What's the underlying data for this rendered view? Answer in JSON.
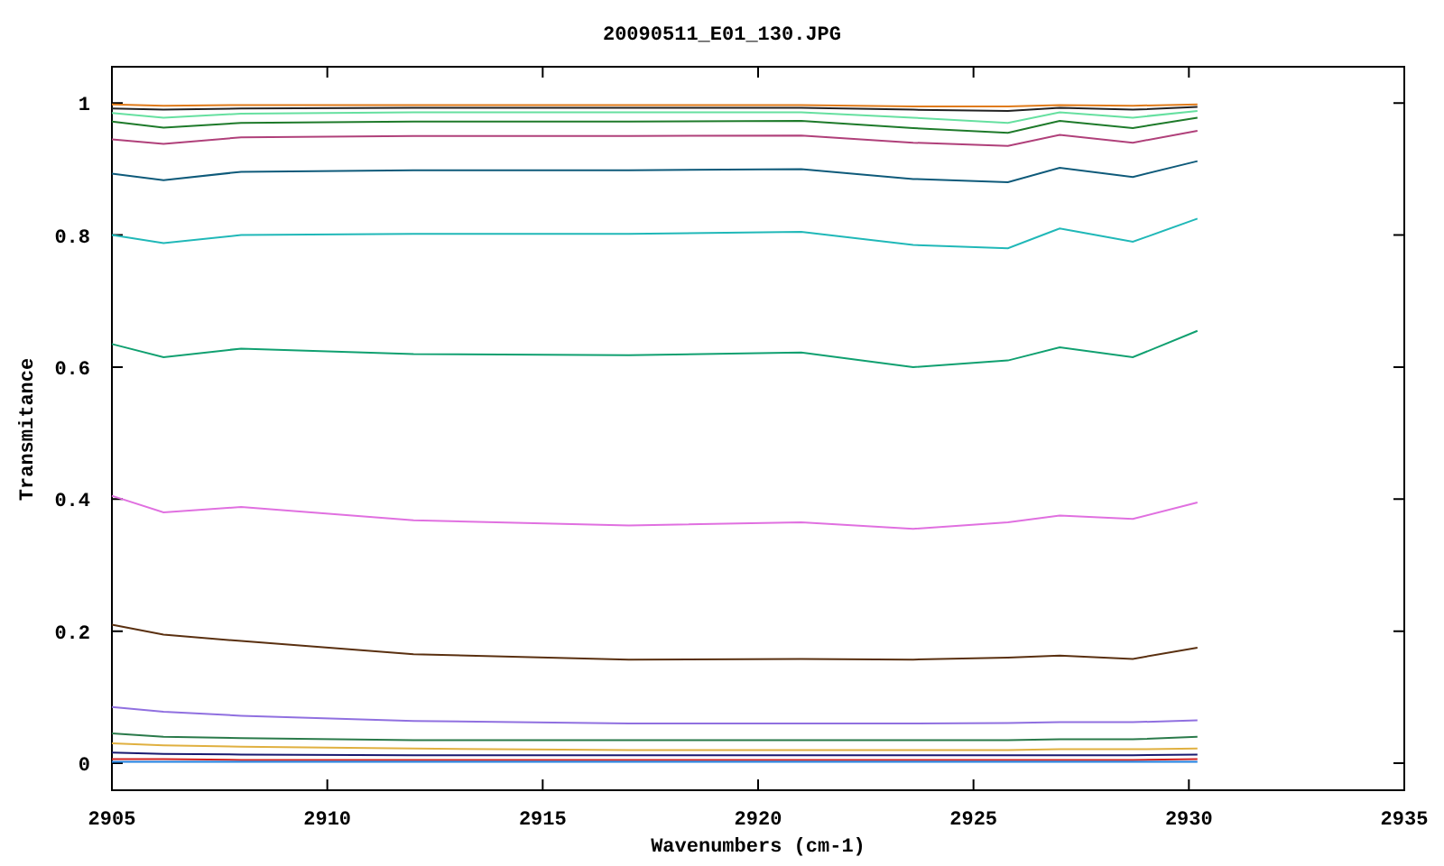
{
  "chart": {
    "chart_data": {
      "type": "line",
      "title": "20090511_E01_130.JPG",
      "xlabel": "Wavenumbers (cm-1)",
      "ylabel": "Transmitance",
      "x": [
        2905,
        2906.2,
        2908,
        2912,
        2917,
        2921,
        2923.6,
        2925.8,
        2927,
        2928.7,
        2930.2
      ],
      "xlim": [
        2905,
        2935
      ],
      "ylim": [
        -0.041,
        1.055
      ],
      "xticks": [
        2905,
        2910,
        2915,
        2920,
        2925,
        2930,
        2935
      ],
      "yticks": [
        0,
        0.2,
        0.4,
        0.6,
        0.8,
        1
      ],
      "series": [
        {
          "color": "#e07b1a",
          "values": [
            0.998,
            0.996,
            0.997,
            0.997,
            0.997,
            0.997,
            0.995,
            0.995,
            0.997,
            0.996,
            0.998
          ]
        },
        {
          "color": "#222222",
          "values": [
            0.992,
            0.99,
            0.992,
            0.993,
            0.993,
            0.993,
            0.99,
            0.988,
            0.993,
            0.99,
            0.994
          ]
        },
        {
          "color": "#66e0a0",
          "values": [
            0.985,
            0.978,
            0.984,
            0.986,
            0.986,
            0.986,
            0.978,
            0.97,
            0.986,
            0.978,
            0.988
          ]
        },
        {
          "color": "#1e7a2a",
          "values": [
            0.972,
            0.963,
            0.97,
            0.972,
            0.972,
            0.973,
            0.962,
            0.955,
            0.973,
            0.962,
            0.978
          ]
        },
        {
          "color": "#b0407a",
          "values": [
            0.945,
            0.938,
            0.948,
            0.95,
            0.95,
            0.951,
            0.94,
            0.935,
            0.952,
            0.94,
            0.958
          ]
        },
        {
          "color": "#0e5a7a",
          "values": [
            0.893,
            0.883,
            0.896,
            0.898,
            0.898,
            0.9,
            0.885,
            0.88,
            0.902,
            0.888,
            0.912
          ]
        },
        {
          "color": "#20b8b8",
          "values": [
            0.8,
            0.788,
            0.8,
            0.802,
            0.802,
            0.805,
            0.785,
            0.78,
            0.81,
            0.79,
            0.825
          ]
        },
        {
          "color": "#10a070",
          "values": [
            0.635,
            0.615,
            0.628,
            0.62,
            0.618,
            0.622,
            0.6,
            0.61,
            0.63,
            0.615,
            0.655
          ]
        },
        {
          "color": "#e070e0",
          "values": [
            0.405,
            0.38,
            0.388,
            0.368,
            0.36,
            0.365,
            0.355,
            0.365,
            0.375,
            0.37,
            0.395
          ]
        },
        {
          "color": "#5a3010",
          "values": [
            0.21,
            0.195,
            0.185,
            0.165,
            0.157,
            0.158,
            0.157,
            0.16,
            0.163,
            0.158,
            0.175
          ]
        },
        {
          "color": "#9070e0",
          "values": [
            0.085,
            0.078,
            0.072,
            0.064,
            0.06,
            0.06,
            0.06,
            0.061,
            0.062,
            0.062,
            0.065
          ]
        },
        {
          "color": "#2a7a4a",
          "values": [
            0.045,
            0.04,
            0.038,
            0.035,
            0.035,
            0.035,
            0.035,
            0.035,
            0.036,
            0.036,
            0.04
          ]
        },
        {
          "color": "#e0b040",
          "values": [
            0.03,
            0.027,
            0.025,
            0.022,
            0.02,
            0.02,
            0.02,
            0.02,
            0.021,
            0.021,
            0.022
          ]
        },
        {
          "color": "#1a1a70",
          "values": [
            0.016,
            0.014,
            0.013,
            0.012,
            0.012,
            0.012,
            0.012,
            0.012,
            0.012,
            0.012,
            0.013
          ]
        },
        {
          "color": "#d02020",
          "values": [
            0.006,
            0.006,
            0.005,
            0.005,
            0.005,
            0.005,
            0.005,
            0.005,
            0.005,
            0.005,
            0.006
          ]
        },
        {
          "color": "#2080e0",
          "values": [
            0.002,
            0.002,
            0.002,
            0.002,
            0.002,
            0.002,
            0.002,
            0.002,
            0.002,
            0.002,
            0.002
          ]
        }
      ]
    }
  }
}
